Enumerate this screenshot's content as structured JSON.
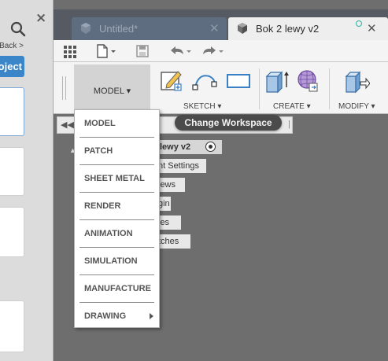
{
  "left_panel": {
    "back_label": "Back >",
    "project_button": "oject",
    "icons": [
      "close-icon",
      "search-icon"
    ]
  },
  "tabs": [
    {
      "label": "Untitled*",
      "icon": "box-icon",
      "active": false
    },
    {
      "label": "Bok 2 lewy v2",
      "icon": "box-icon",
      "active": true
    }
  ],
  "toolbar": {
    "icons": [
      "grid-icon",
      "file-icon",
      "save-icon",
      "undo-icon",
      "redo-icon"
    ]
  },
  "ribbon": {
    "workspace_label": "MODEL ▾",
    "groups": [
      {
        "label": "SKETCH ▾"
      },
      {
        "label": "CREATE ▾"
      },
      {
        "label": "MODIFY ▾"
      }
    ]
  },
  "tooltip": "Change Workspace",
  "workspace_menu": {
    "items": [
      "MODEL",
      "PATCH",
      "SHEET METAL",
      "RENDER",
      "ANIMATION",
      "SIMULATION",
      "MANUFACTURE",
      "DRAWING"
    ]
  },
  "browser": {
    "root": "lewy v2",
    "nodes": [
      "nt Settings",
      "iews",
      "gin",
      "ies",
      "tches"
    ]
  },
  "colors": {
    "canvas": "#6e6e6e",
    "tab_bar": "#565b63",
    "accent": "#3b86c8"
  }
}
